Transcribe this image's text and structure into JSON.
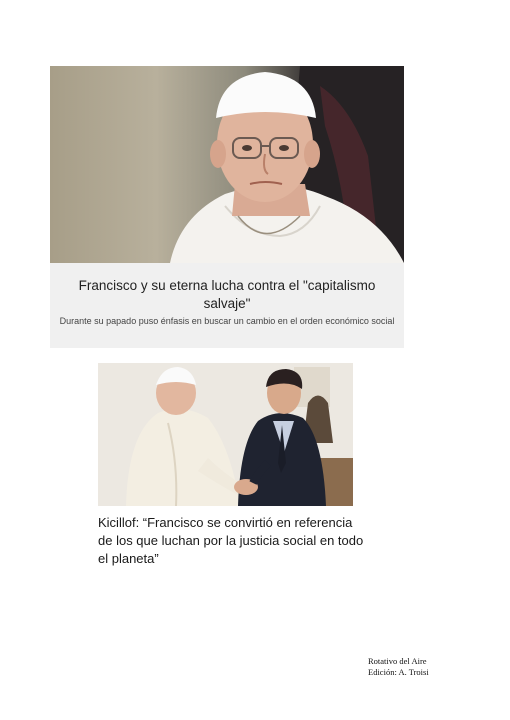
{
  "article_1": {
    "title": "Francisco y su eterna lucha contra el \"capitalismo salvaje\"",
    "subtitle": "Durante su papado puso énfasis en buscar un cambio en el orden económico social"
  },
  "article_2": {
    "title": "Kicillof: “Francisco se convirtió en referencia de los que luchan por la justicia social en todo el planeta”"
  },
  "credits": {
    "line1": "Rotativo del Aire",
    "line2": "Edición: A. Troisi"
  }
}
